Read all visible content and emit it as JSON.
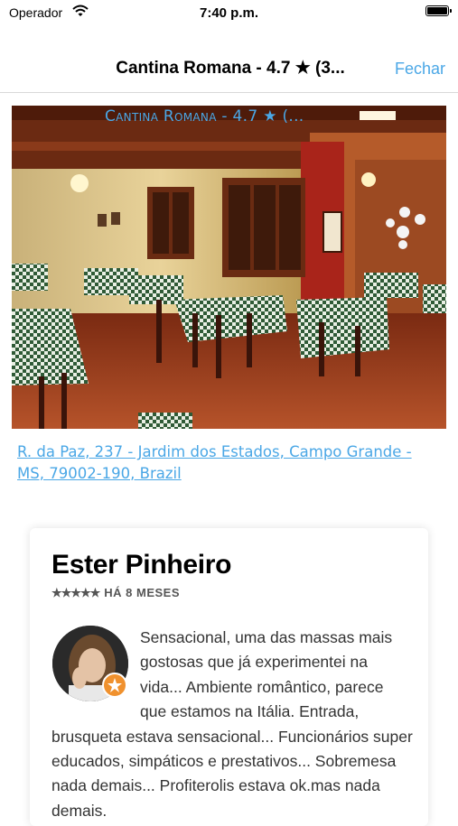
{
  "status_bar": {
    "carrier": "Operador",
    "time": "7:40 p.m."
  },
  "nav": {
    "title": "Cantina Romana - 4.7 ★ (3...",
    "close_label": "Fechar"
  },
  "hero": {
    "caption": "Cantina Romana - 4.7 ★ (..."
  },
  "address": "R. da Paz, 237 - Jardim dos Estados, Campo Grande - MS, 79002-190, Brazil",
  "review": {
    "author": "Ester Pinheiro",
    "stars": "★★★★★",
    "time_ago": "HÁ 8 MESES",
    "text": "Sensacional, uma das massas mais gostosas que já experimentei na vida... Ambiente romântico, parece que estamos na Itália. Entrada, brusqueta estava sensacional... Funcionários super educados, simpáticos e prestativos... Sobremesa nada demais... Profiterolis estava ok.mas nada demais."
  },
  "colors": {
    "accent": "#4aa7e6",
    "badge": "#f0912e"
  },
  "icons": {
    "wifi": "wifi-icon",
    "battery": "battery-icon",
    "badge": "local-guide-badge-icon"
  }
}
